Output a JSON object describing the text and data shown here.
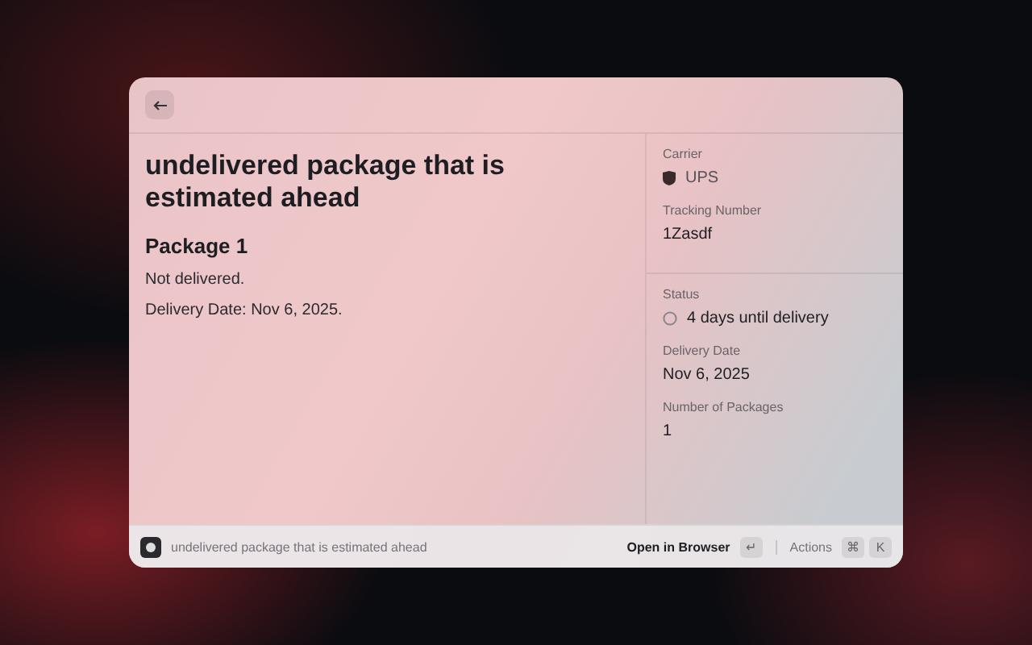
{
  "detail": {
    "title": "undelivered package that is estimated ahead",
    "heading": "Package 1",
    "lines": [
      "Not delivered.",
      "Delivery Date: Nov 6, 2025."
    ]
  },
  "metadata": [
    [
      {
        "label": "Carrier",
        "value": "UPS",
        "kind": "carrier"
      },
      {
        "label": "Tracking Number",
        "value": "1Zasdf",
        "kind": "plain"
      }
    ],
    [
      {
        "label": "Status",
        "value": "4 days until delivery",
        "kind": "status"
      },
      {
        "label": "Delivery Date",
        "value": "Nov 6, 2025",
        "kind": "plain"
      },
      {
        "label": "Number of Packages",
        "value": "1",
        "kind": "plain"
      }
    ]
  ],
  "action_bar": {
    "title": "undelivered package that is estimated ahead",
    "primary": {
      "label": "Open in Browser",
      "keys": [
        "↵"
      ]
    },
    "secondary": {
      "label": "Actions",
      "keys": [
        "⌘",
        "K"
      ]
    }
  }
}
